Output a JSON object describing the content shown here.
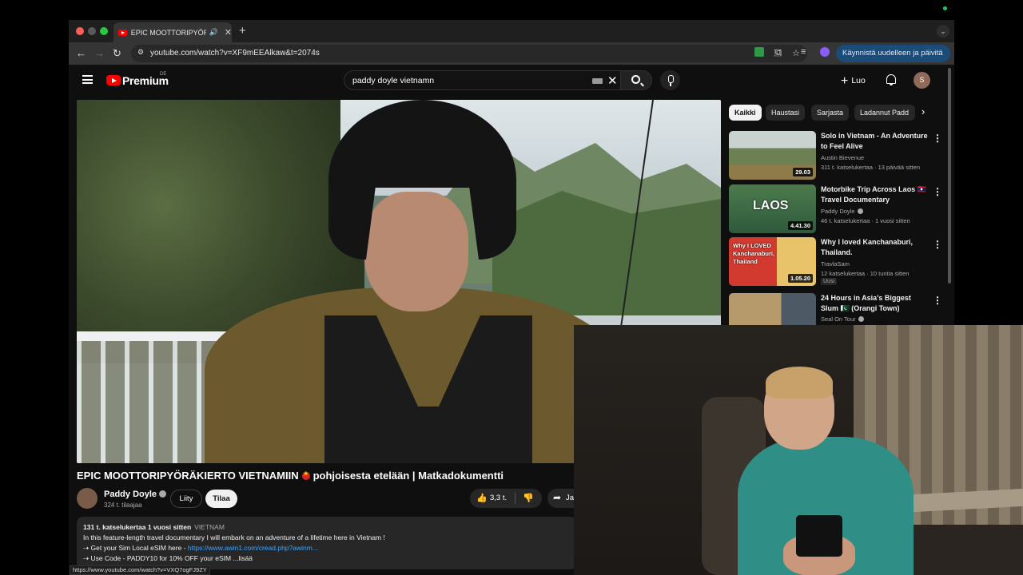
{
  "browser": {
    "tab_title": "EPIC MOOTTORIPYÖRÄK",
    "url": "youtube.com/watch?v=XF9mEEAlkaw&t=2074s",
    "relaunch_label": "Käynnistä uudelleen ja päivitä",
    "profile_initial": "S",
    "status_url": "https://www.youtube.com/watch?v=VXQ7ogFJ9ZY"
  },
  "youtube": {
    "brand": "Premium",
    "brand_country": "DE",
    "search_value": "paddy doyle vietnamn",
    "create_label": "Luo",
    "avatar_initial": "S"
  },
  "video": {
    "title_part1": "EPIC MOOTTORIPYÖRÄKIERTO VIETNAMIIN",
    "title_part2": "pohjoisesta etelään | Matkadokumentti",
    "channel": "Paddy Doyle",
    "subscribers": "324 t. tilaajaa",
    "join_label": "Liity",
    "subscribe_label": "Tilaa",
    "likes": "3,3 t.",
    "share_label": "Ja",
    "description": {
      "views": "131 t. katselukertaa",
      "date": "1 vuosi sitten",
      "tag": "VIETNAM",
      "line1": "In this feature-length travel documentary I will embark on an adventure of a lifetime here in Vietnam !",
      "line2_prefix": "Get your Sim Local eSIM here - ",
      "line2_link": "https://www.awin1.com/cread.php?awinm...",
      "line3": "Use Code - PADDY10 for 10% OFF your eSIM",
      "more": "...lisää"
    }
  },
  "sidebar": {
    "chips": [
      "Kaikki",
      "Haustasi",
      "Sarjasta",
      "Ladannut Padd"
    ],
    "recommendations": [
      {
        "title": "Solo in Vietnam - An Adventure to Feel Alive",
        "channel": "Austin Bievenue",
        "meta": "311 t. katselukertaa · 13 päivää sitten",
        "duration": "29.03"
      },
      {
        "title": "Motorbike Trip Across Laos 🇱🇦 Travel Documentary",
        "channel": "Paddy Doyle",
        "meta": "46 t. katselukertaa · 1 vuosi sitten",
        "duration": "4.41.30",
        "thumb_text": "LAOS"
      },
      {
        "title": "Why I loved Kanchanaburi, Thailand.",
        "channel": "TravlaSam",
        "meta": "12 katselukertaa · 10 tuntia sitten",
        "duration": "1.05.20",
        "badge": "Uusi",
        "thumb_text": "Why I LOVED Kanchanaburi, Thailand"
      },
      {
        "title": "24 Hours in Asia's Biggest Slum 🇵🇰 (Orangi Town)",
        "channel": "Seal On Tour",
        "meta": "",
        "duration": ""
      }
    ]
  },
  "colors": {
    "accent_red": "#ff0000",
    "link_blue": "#3ea6ff",
    "relaunch_bg": "#1b4b77"
  },
  "icons": [
    "close-icon",
    "plus-icon",
    "back-icon",
    "forward-icon",
    "reload-icon",
    "search-icon",
    "mic-icon",
    "bell-icon",
    "like-icon",
    "dislike-icon",
    "share-icon",
    "more-vert-icon",
    "chevron-right-icon",
    "menu-icon",
    "star-icon",
    "cast-icon",
    "puzzle-icon"
  ]
}
